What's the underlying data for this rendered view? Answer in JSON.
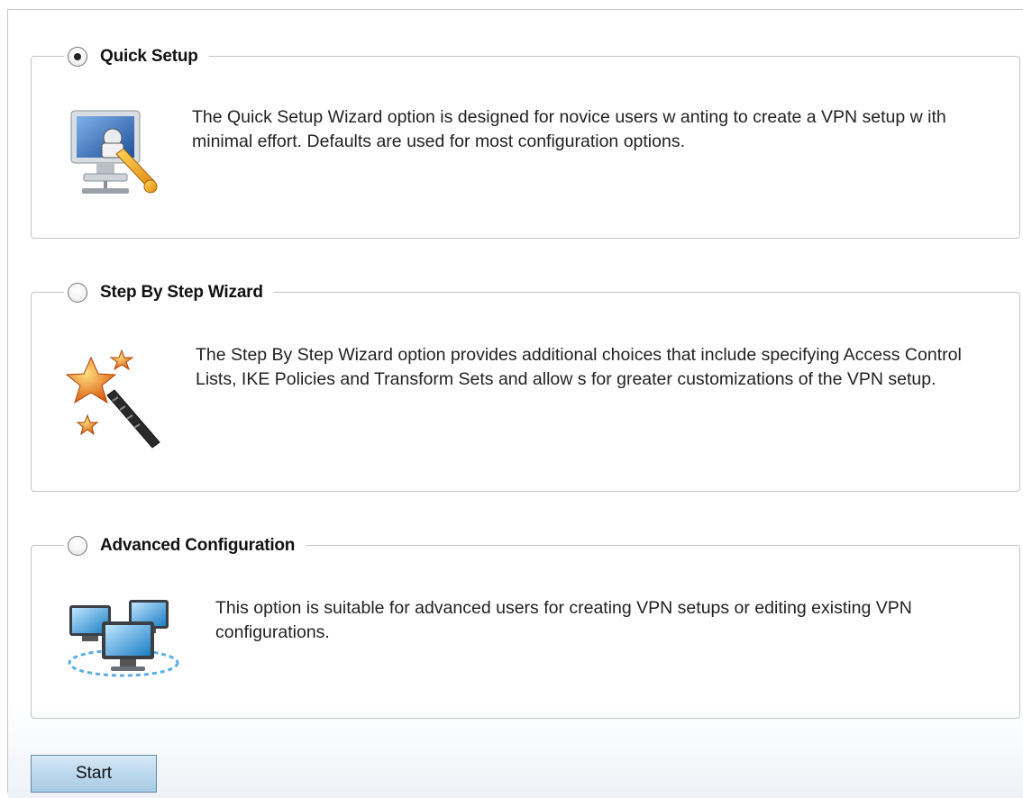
{
  "options": [
    {
      "label": "Quick Setup",
      "selected": true,
      "icon": "monitor-wrench-icon",
      "description": "The Quick Setup Wizard option is designed for novice users w anting to create a VPN setup w ith minimal effort. Defaults are used for most configuration options."
    },
    {
      "label": "Step By Step Wizard",
      "selected": false,
      "icon": "magic-wand-stars-icon",
      "description": "The Step By Step Wizard option provides additional choices that include specifying Access Control Lists, IKE Policies and Transform Sets and allow s for greater customizations of the VPN setup."
    },
    {
      "label": "Advanced Configuration",
      "selected": false,
      "icon": "networked-computers-icon",
      "description": "This option is suitable for advanced users for creating VPN setups or editing existing VPN configurations."
    }
  ],
  "start_button": {
    "label": "Start"
  }
}
